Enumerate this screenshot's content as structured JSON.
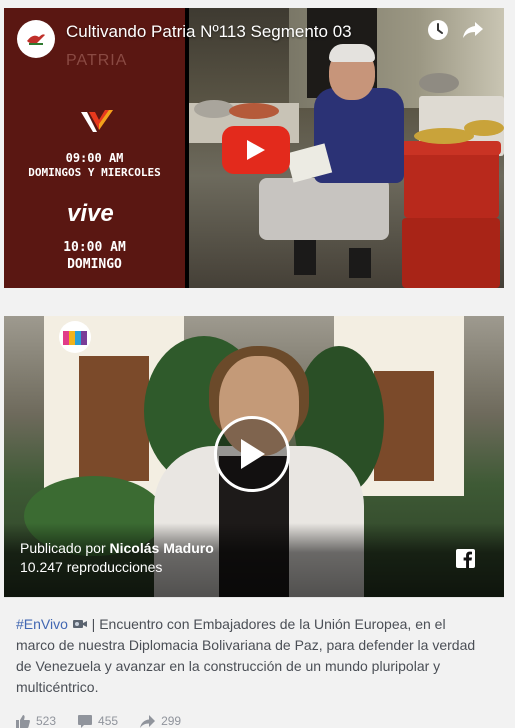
{
  "video1": {
    "title": "Cultivando Patria Nº113 Segmento 03",
    "watermark": "PATRIA",
    "schedule1_time": "09:00 AM",
    "schedule1_days": "DOMINGOS Y MIERCOLES",
    "vive_logo": "vive",
    "schedule2_time": "10:00 AM",
    "schedule2_days": "DOMINGO",
    "icons": [
      "watch-later-icon",
      "share-icon",
      "youtube-play-icon"
    ]
  },
  "video2": {
    "published_prefix": "Publicado por ",
    "author": "Nicolás Maduro",
    "views": "10.247 reproducciones",
    "icons": [
      "play-icon",
      "facebook-icon"
    ]
  },
  "post": {
    "hashtag": "#EnVivo",
    "text": " | Encuentro con Embajadores de la Unión Europea, en el marco de nuestra Diplomacia Bolivariana de Paz, para defender la verdad de Venezuela y avanzar en la construcción de un mundo pluripolar y multicéntrico.",
    "likes": "523",
    "comments": "455",
    "shares": "299"
  },
  "colors": {
    "panel_red": "#5a1712",
    "youtube_red": "#e32a1c",
    "link_blue": "#4267b2"
  }
}
